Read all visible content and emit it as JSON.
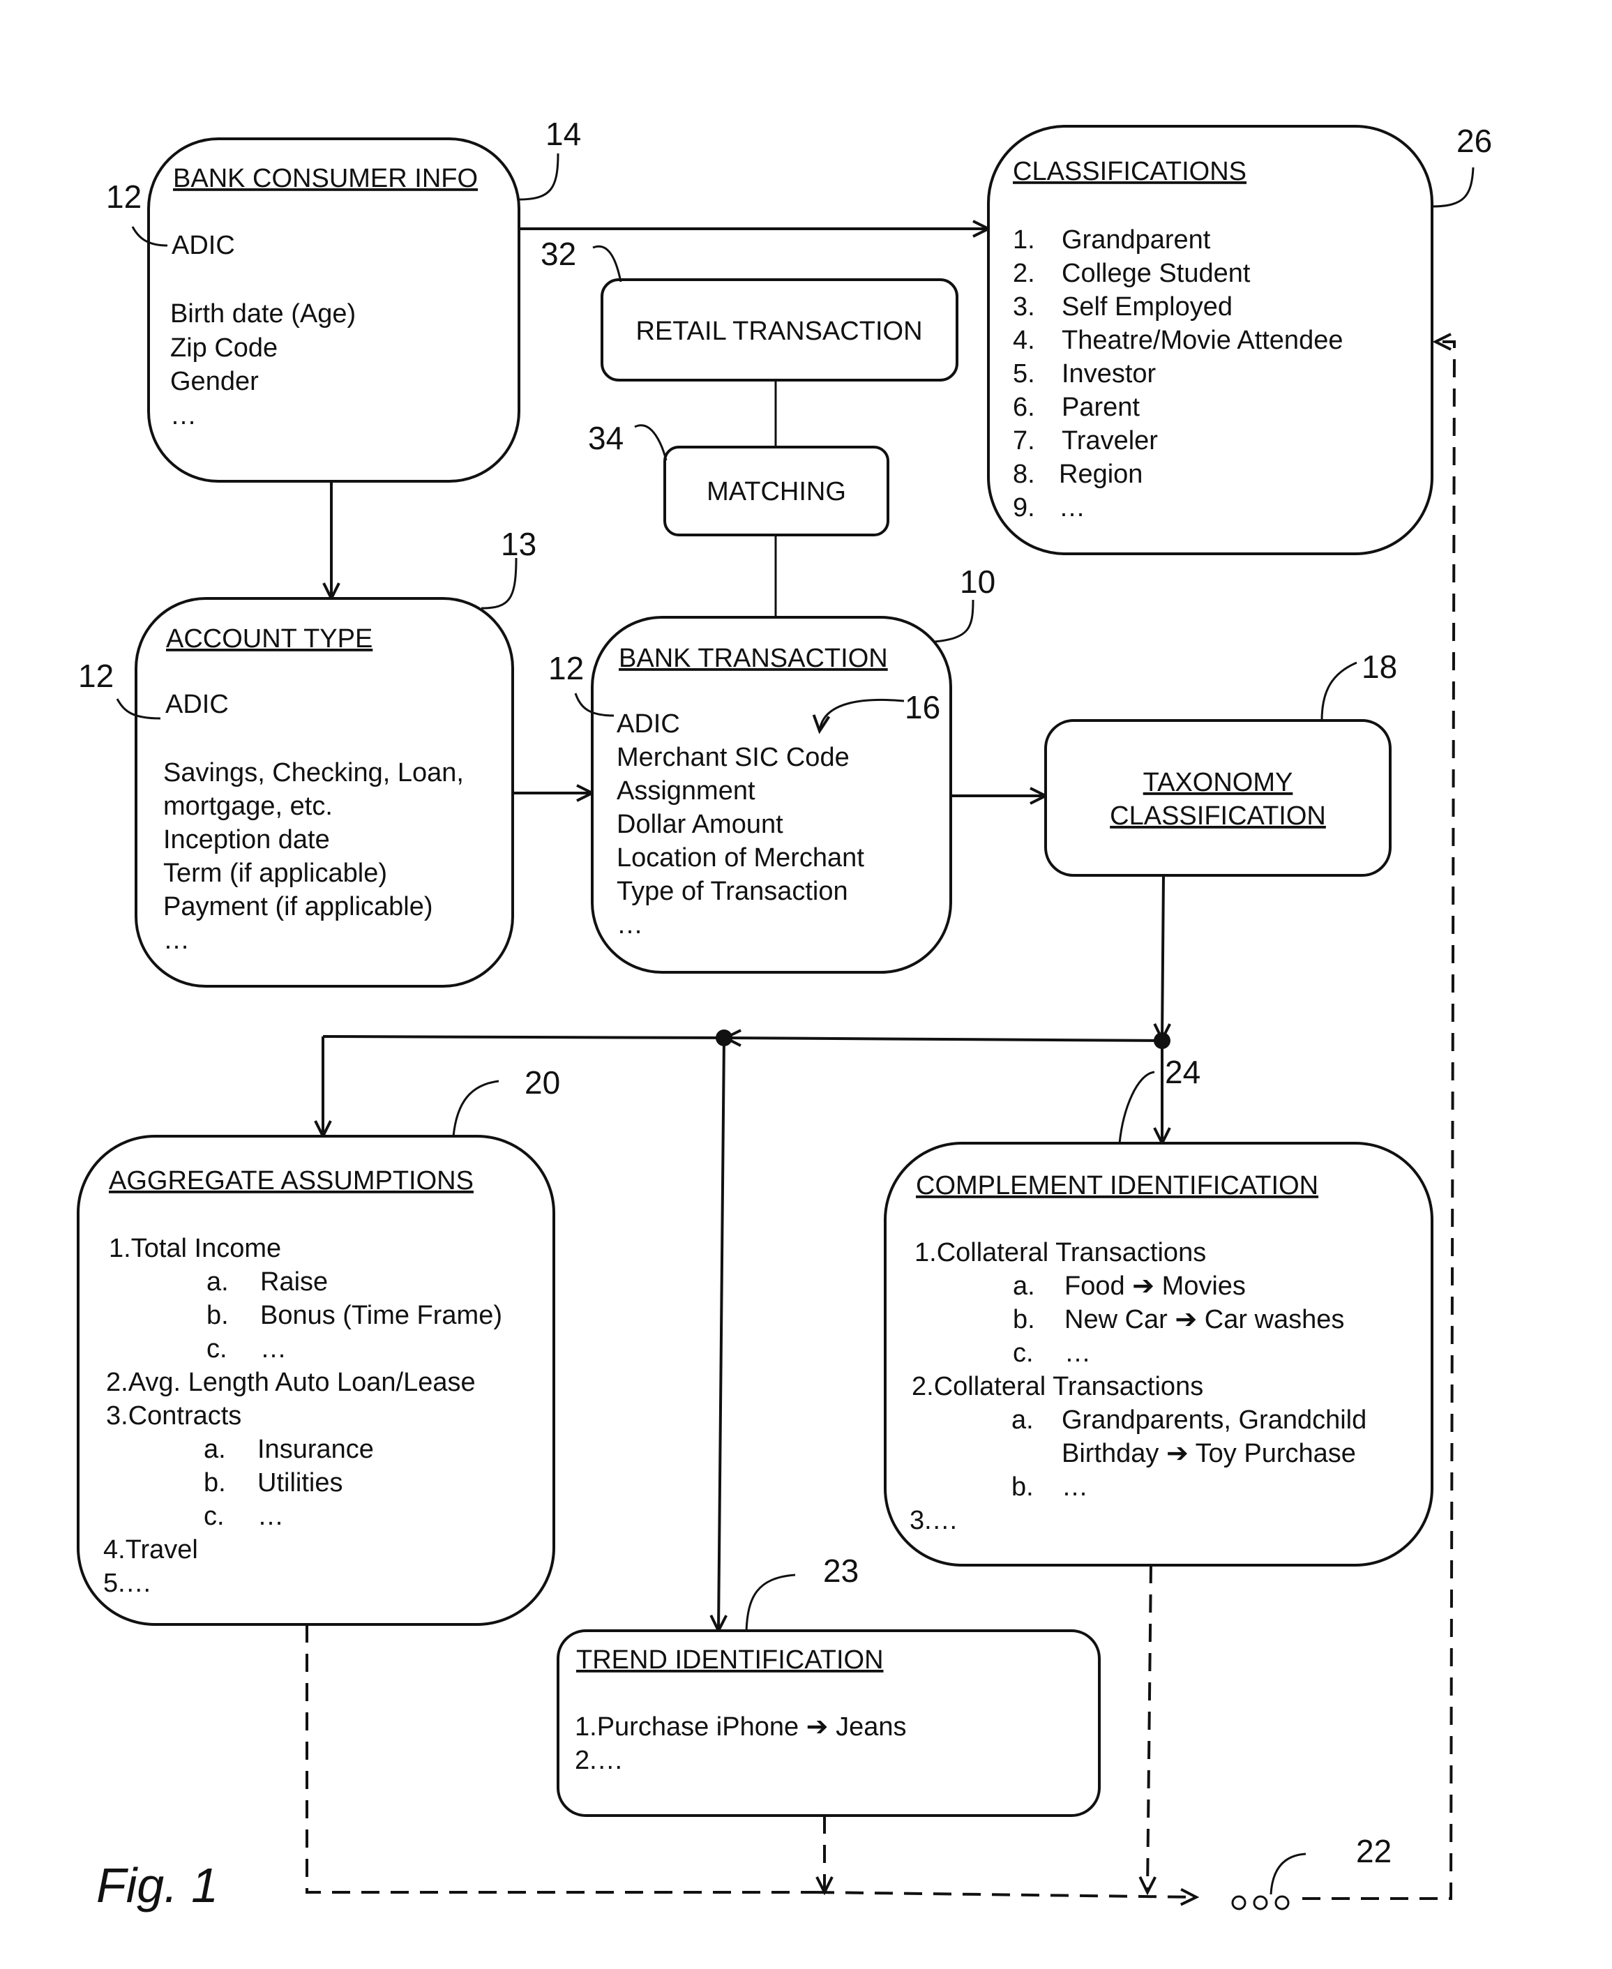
{
  "figure_label": "Fig. 1",
  "boxes": {
    "bank_consumer_info": {
      "ref": "14",
      "title": "BANK CONSUMER INFO",
      "adic_ref": "12",
      "lines": [
        "ADIC",
        "Birth date (Age)",
        "Zip Code",
        "Gender",
        "…"
      ]
    },
    "classifications": {
      "ref": "26",
      "title": "CLASSIFICATIONS",
      "items": [
        {
          "num": "1.",
          "label": "Grandparent"
        },
        {
          "num": "2.",
          "label": "College Student"
        },
        {
          "num": "3.",
          "label": "Self Employed"
        },
        {
          "num": "4.",
          "label": "Theatre/Movie Attendee"
        },
        {
          "num": "5.",
          "label": "Investor"
        },
        {
          "num": "6.",
          "label": "Parent"
        },
        {
          "num": "7.",
          "label": "Traveler"
        },
        {
          "num": "8.",
          "label": "Region"
        },
        {
          "num": "9.",
          "label": "…"
        }
      ]
    },
    "retail_transaction": {
      "ref": "32",
      "title": "RETAIL TRANSACTION"
    },
    "matching": {
      "ref": "34",
      "title": "MATCHING"
    },
    "account_type": {
      "ref": "13",
      "title": "ACCOUNT TYPE",
      "adic_ref": "12",
      "lines": [
        "ADIC",
        "Savings, Checking, Loan,",
        "mortgage, etc.",
        "Inception date",
        "Term (if applicable)",
        "Payment (if applicable)",
        "…"
      ]
    },
    "bank_transaction": {
      "ref": "10",
      "title": "BANK TRANSACTION",
      "adic_ref": "12",
      "sic_ref": "16",
      "lines": [
        "ADIC",
        "Merchant SIC Code",
        "Assignment",
        "Dollar Amount",
        "Location of Merchant",
        "Type of Transaction",
        "…"
      ]
    },
    "taxonomy_classification": {
      "ref": "18",
      "title_line1": "TAXONOMY",
      "title_line2": "CLASSIFICATION"
    },
    "aggregate_assumptions": {
      "ref": "20",
      "title": "AGGREGATE ASSUMPTIONS",
      "lines": [
        {
          "indent": false,
          "text": "1.Total Income"
        },
        {
          "indent": true,
          "num": "a.",
          "text": "Raise"
        },
        {
          "indent": true,
          "num": "b.",
          "text": "Bonus (Time Frame)"
        },
        {
          "indent": true,
          "num": "c.",
          "text": "…"
        },
        {
          "indent": false,
          "text": "2.Avg. Length Auto Loan/Lease"
        },
        {
          "indent": false,
          "text": "3.Contracts"
        },
        {
          "indent": true,
          "num": "a.",
          "text": "Insurance"
        },
        {
          "indent": true,
          "num": "b.",
          "text": "Utilities"
        },
        {
          "indent": true,
          "num": "c.",
          "text": "…"
        },
        {
          "indent": false,
          "text": "4.Travel"
        },
        {
          "indent": false,
          "text": "5.…"
        }
      ]
    },
    "complement_identification": {
      "ref": "24",
      "title": "COMPLEMENT IDENTIFICATION",
      "lines": [
        {
          "indent": false,
          "text": "1.Collateral Transactions"
        },
        {
          "indent": true,
          "num": "a.",
          "text": "Food ➔ Movies"
        },
        {
          "indent": true,
          "num": "b.",
          "text": "New Car ➔ Car washes"
        },
        {
          "indent": true,
          "num": "c.",
          "text": "…"
        },
        {
          "indent": false,
          "text": "2.Collateral Transactions"
        },
        {
          "indent": true,
          "num": "a.",
          "text": "Grandparents, Grandchild"
        },
        {
          "indent": true,
          "num": "",
          "text": "Birthday ➔ Toy Purchase"
        },
        {
          "indent": true,
          "num": "b.",
          "text": "…"
        },
        {
          "indent": false,
          "text": "3.…"
        }
      ]
    },
    "trend_identification": {
      "ref": "23",
      "title": "TREND IDENTIFICATION",
      "lines": [
        "1.Purchase iPhone ➔ Jeans",
        "2.…"
      ]
    },
    "output_node": {
      "ref": "22",
      "glyph": "○ ○ ○"
    }
  }
}
